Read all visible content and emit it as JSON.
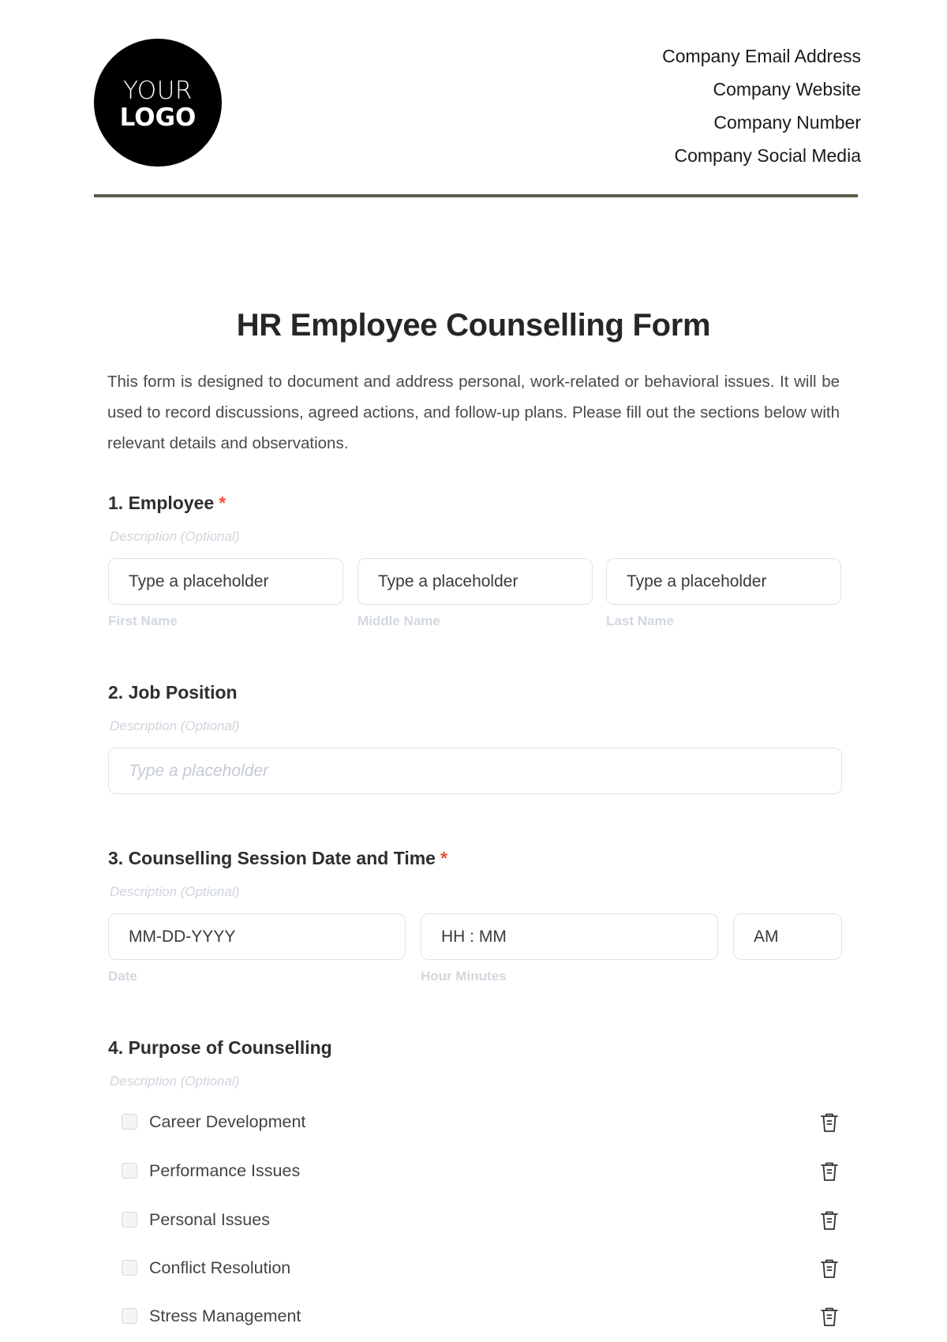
{
  "header": {
    "logo": {
      "line1": "YOUR",
      "line2": "LOGO"
    },
    "company_info": [
      "Company Email Address",
      "Company Website",
      "Company Number",
      "Company Social Media"
    ]
  },
  "form": {
    "title": "HR Employee Counselling Form",
    "description": "This form is designed to document and address personal, work-related or behavioral issues. It will be used to record discussions, agreed actions, and follow-up plans. Please fill out the sections below with relevant details and observations.",
    "required_marker": "*",
    "sections": [
      {
        "title": "1. Employee",
        "required": true,
        "description": "Description (Optional)",
        "fields": [
          {
            "value": "Type a placeholder",
            "label": "First Name"
          },
          {
            "value": "Type a placeholder",
            "label": "Middle Name"
          },
          {
            "value": "Type a placeholder",
            "label": "Last Name"
          }
        ]
      },
      {
        "title": "2. Job Position",
        "required": false,
        "description": "Description (Optional)",
        "fields": [
          {
            "placeholder": "Type a placeholder"
          }
        ]
      },
      {
        "title": "3. Counselling Session Date and Time",
        "required": true,
        "description": "Description (Optional)",
        "fields": [
          {
            "value": "MM-DD-YYYY",
            "label": "Date"
          },
          {
            "value": "HH : MM",
            "label": "Hour Minutes"
          },
          {
            "value": "AM",
            "label": ""
          }
        ]
      },
      {
        "title": "4. Purpose of Counselling",
        "required": false,
        "description": "Description (Optional)",
        "options": [
          {
            "label": "Career Development",
            "checked": false,
            "icon": "trash-icon"
          },
          {
            "label": "Performance Issues",
            "checked": false,
            "icon": "trash-icon"
          },
          {
            "label": "Personal Issues",
            "checked": false,
            "icon": "trash-icon"
          },
          {
            "label": "Conflict Resolution",
            "checked": false,
            "icon": "trash-icon"
          },
          {
            "label": "Stress Management",
            "checked": false,
            "icon": "trash-icon"
          }
        ]
      }
    ]
  },
  "colors": {
    "divider": "#5b5c4a",
    "required": "#ef4e3a",
    "muted": "#d3d8df"
  }
}
